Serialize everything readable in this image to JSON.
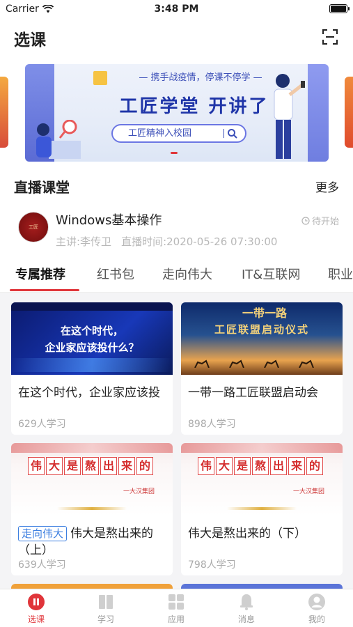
{
  "status_bar": {
    "carrier": "Carrier",
    "time": "3:48 PM"
  },
  "header": {
    "title": "选课"
  },
  "banner": {
    "slogan": "— 携手战疫情，停课不停学 —",
    "headline": "工匠学堂  开讲了",
    "search_text": "工匠精神入校园"
  },
  "live": {
    "section_title": "直播课堂",
    "more_label": "更多",
    "course_title": "Windows基本操作",
    "status": "待开始",
    "lecturer": "主讲:李传卫",
    "live_time": "直播时间:2020-05-26 07:30:00"
  },
  "tabs": [
    "专属推荐",
    "红书包",
    "走向伟大",
    "IT&互联网",
    "职业"
  ],
  "cards": [
    {
      "title": "在这个时代，企业家应该投",
      "count": "629人学习",
      "thumb_lines": [
        "在这个时代，",
        "企业家应该投什么？"
      ]
    },
    {
      "title": "一带一路工匠联盟启动会",
      "count": "898人学习",
      "thumb_lines": [
        "工匠联盟启动仪式",
        "一带一路"
      ]
    },
    {
      "tag": "走向伟大",
      "title": "伟大是熬出来的（上）",
      "count": "639人学习",
      "thumb_chars": [
        "伟",
        "大",
        "是",
        "熬",
        "出",
        "来",
        "的"
      ],
      "thumb_sign": "一大汉集团"
    },
    {
      "title": "伟大是熬出来的（下）",
      "count": "798人学习",
      "thumb_chars": [
        "伟",
        "大",
        "是",
        "熬",
        "出",
        "来",
        "的"
      ],
      "thumb_sign": "一大汉集团"
    }
  ],
  "tabbar": [
    {
      "label": "选课",
      "icon": "pause-circle-icon",
      "active": true
    },
    {
      "label": "学习",
      "icon": "book-icon",
      "active": false
    },
    {
      "label": "应用",
      "icon": "grid-icon",
      "active": false
    },
    {
      "label": "消息",
      "icon": "bell-icon",
      "active": false
    },
    {
      "label": "我的",
      "icon": "user-icon",
      "active": false
    }
  ],
  "colors": {
    "accent": "#e0353a",
    "tag_blue": "#3d7fe0",
    "banner_blue": "#1f35a8"
  }
}
